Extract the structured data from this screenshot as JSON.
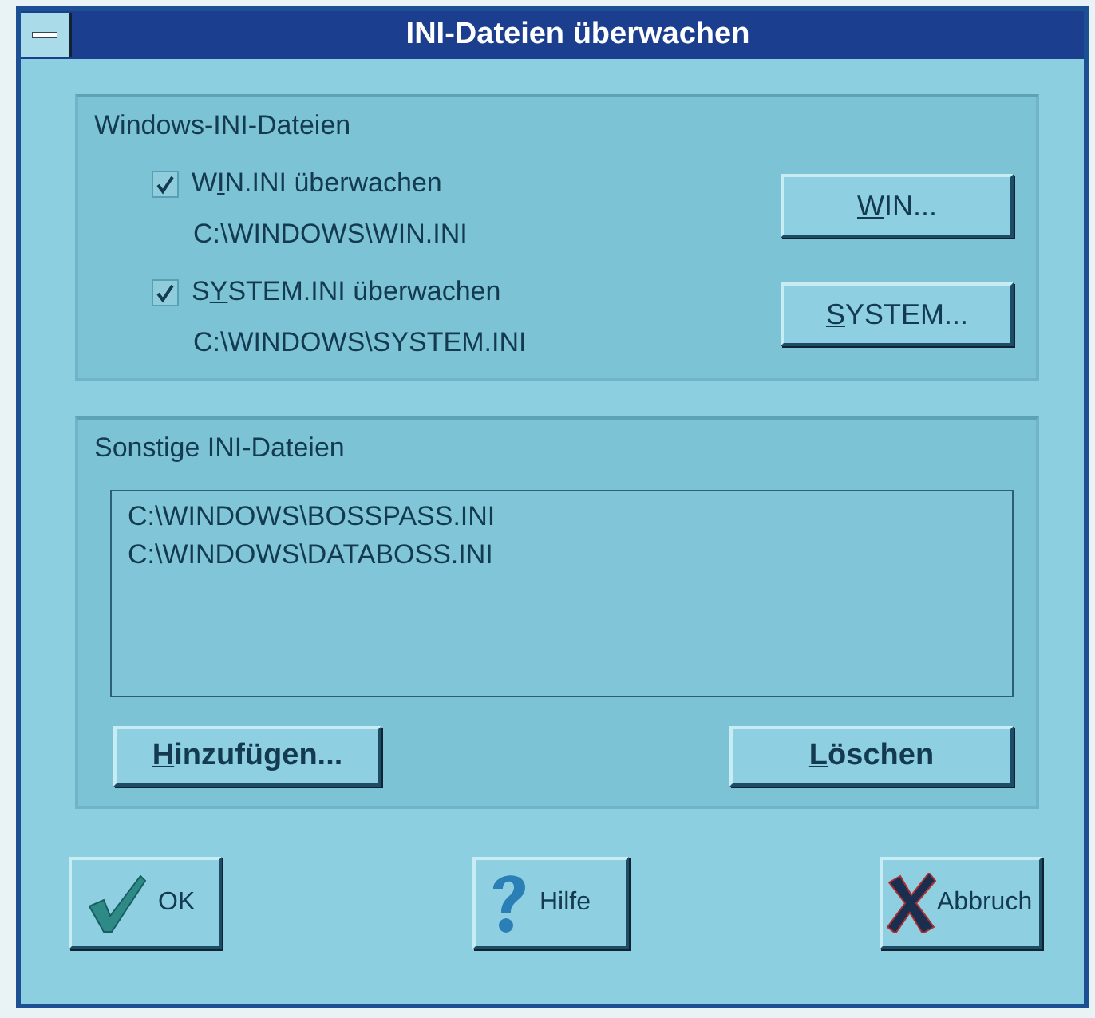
{
  "window": {
    "title": "INI-Dateien überwachen"
  },
  "windows_group": {
    "title": "Windows-INI-Dateien",
    "items": [
      {
        "checked": true,
        "label": {
          "before": "W",
          "key": "I",
          "after": "N.INI überwachen"
        },
        "path": "C:\\WINDOWS\\WIN.INI",
        "button": {
          "key": "W",
          "after": "IN..."
        }
      },
      {
        "checked": true,
        "label": {
          "before": "S",
          "key": "Y",
          "after": "STEM.INI überwachen"
        },
        "path": "C:\\WINDOWS\\SYSTEM.INI",
        "button": {
          "key": "S",
          "after": "YSTEM..."
        }
      }
    ]
  },
  "other_group": {
    "title": "Sonstige INI-Dateien",
    "files": [
      "C:\\WINDOWS\\BOSSPASS.INI",
      "C:\\WINDOWS\\DATABOSS.INI"
    ],
    "buttons": [
      {
        "key": "H",
        "after": "inzufügen..."
      },
      {
        "key": "L",
        "after": "öschen"
      }
    ]
  },
  "buttons": [
    {
      "kind": "ok",
      "label": "OK"
    },
    {
      "kind": "help",
      "label": "Hilfe"
    },
    {
      "kind": "cancel",
      "label": "Abbruch"
    }
  ]
}
